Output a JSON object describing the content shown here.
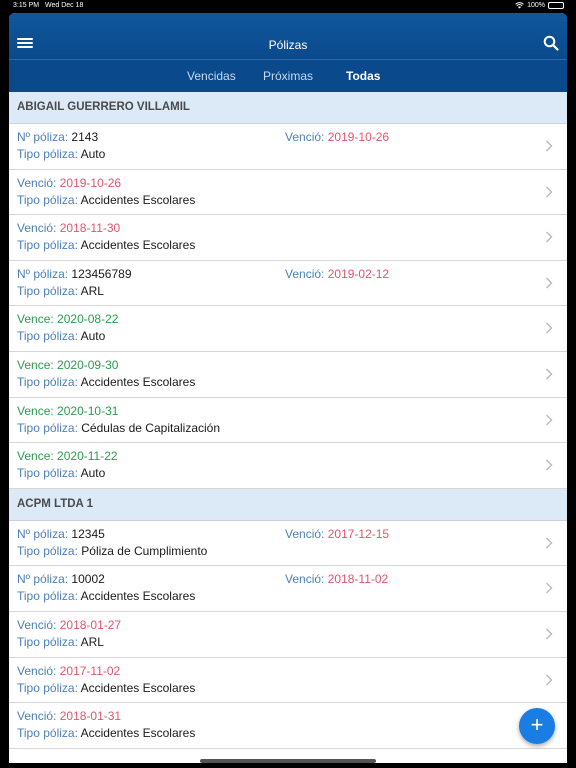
{
  "status_bar": {
    "time": "3:15 PM",
    "date": "Wed Dec 18",
    "battery": "100%"
  },
  "navbar": {
    "title": "Pólizas",
    "menu_icon": "hamburger-menu-icon",
    "search_icon": "search-icon"
  },
  "tabs": [
    {
      "label": "Vencidas",
      "active": false
    },
    {
      "label": "Próximas",
      "active": false
    },
    {
      "label": "Todas",
      "active": true
    }
  ],
  "labels": {
    "policy_number": "Nº póliza:",
    "policy_type": "Tipo póliza:",
    "expired": "Venció:",
    "expires": "Vence:"
  },
  "sections": [
    {
      "name": "ABIGAIL GUERRERO VILLAMIL",
      "rows": [
        {
          "policy_number": "2143",
          "type": "Auto",
          "status": "Venció:",
          "date": "2019-10-26",
          "state": "expired"
        },
        {
          "type": "Accidentes Escolares",
          "status": "Venció:",
          "date": "2019-10-26",
          "state": "expired"
        },
        {
          "type": "Accidentes Escolares",
          "status": "Venció:",
          "date": "2018-11-30",
          "state": "expired"
        },
        {
          "policy_number": "123456789",
          "type": "ARL",
          "status": "Venció:",
          "date": "2019-02-12",
          "state": "expired"
        },
        {
          "type": "Auto",
          "status": "Vence:",
          "date": "2020-08-22",
          "state": "upcoming"
        },
        {
          "type": "Accidentes Escolares",
          "status": "Vence:",
          "date": "2020-09-30",
          "state": "upcoming"
        },
        {
          "type": "Cédulas de Capitalización",
          "status": "Vence:",
          "date": "2020-10-31",
          "state": "upcoming"
        },
        {
          "type": "Auto",
          "status": "Vence:",
          "date": "2020-11-22",
          "state": "upcoming"
        }
      ]
    },
    {
      "name": "ACPM LTDA 1",
      "rows": [
        {
          "policy_number": "12345",
          "type": "Póliza de Cumplimiento",
          "status": "Venció:",
          "date": "2017-12-15",
          "state": "expired"
        },
        {
          "policy_number": "10002",
          "type": "Accidentes Escolares",
          "status": "Venció:",
          "date": "2018-11-02",
          "state": "expired"
        },
        {
          "type": "ARL",
          "status": "Venció:",
          "date": "2018-01-27",
          "state": "expired"
        },
        {
          "type": "Accidentes Escolares",
          "status": "Venció:",
          "date": "2017-11-02",
          "state": "expired"
        },
        {
          "type": "Accidentes Escolares",
          "status": "Venció:",
          "date": "2018-01-31",
          "state": "expired"
        }
      ]
    }
  ],
  "fab": {
    "label": "+",
    "icon": "plus-icon"
  },
  "colors": {
    "navbar": "#0a4a8c",
    "label_blue": "#4c7fb8",
    "expired_red": "#e0566b",
    "upcoming_green": "#2e9a4d",
    "section_bg": "#dceaf8",
    "fab": "#1a7de3"
  }
}
